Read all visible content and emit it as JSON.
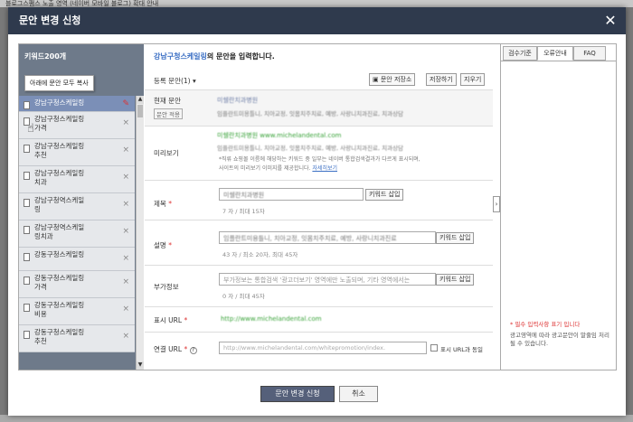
{
  "background": {
    "top_text": "블로그스팸스 노출 영역 (네이버 모바일 블로그) 확대 안내",
    "accent": "#2f3a4d"
  },
  "modal": {
    "title": "문안 변경 신청",
    "close_icon": "close-icon"
  },
  "left_panel": {
    "header": "키워드200개",
    "tooltip": "아래에 문안 모두 복사",
    "items": [
      {
        "label": "강남구청스케일링",
        "selected": true
      },
      {
        "label": "강남구청스케일링\n가격"
      },
      {
        "label": "강남구청스케일링\n추천"
      },
      {
        "label": "강남구청스케일링\n치과"
      },
      {
        "label": "강남구청역스케일\n링"
      },
      {
        "label": "강남구청역스케일\n링치과"
      },
      {
        "label": "강동구청스케일링"
      },
      {
        "label": "강동구청스케일링\n가격"
      },
      {
        "label": "강동구청스케일링\n비용"
      },
      {
        "label": "강동구청스케일링\n추천"
      }
    ]
  },
  "center": {
    "heading_keyword": "강남구청스케일링",
    "heading_rest": "의 문안을 입력합니다.",
    "toolbar": {
      "select_label": "등록 문안(1)",
      "save_btn": "문안 저장소",
      "temp_save_btn": "저장하기",
      "clear_btn": "지우기"
    },
    "current": {
      "label": "현재 문안",
      "tag": "문안 적용",
      "line1": "미쉘란치과병원",
      "line2": "임플란트미용틀니, 치아교정, 잇몸치주치료, 예방, 사랑니치과진료, 치과상담"
    },
    "preview": {
      "label": "미리보기",
      "line1": "미쉘란치과병원 www.michelandental.com",
      "line2": "임플란트미용틀니, 치아교정, 잇몸치주치료, 예방, 사랑니치과진료, 치과상담",
      "note": "*직류 쇼핑몰 이름에 해당하는 키워드 중 일부는 네이버 통합검색결과가 다르게 표시되며,",
      "note2": "사이트의 미리보기 이미지를 제공합니다.",
      "note_link": "자세히보기"
    },
    "title_field": {
      "label": "제목",
      "value": "미쉘란치과병원",
      "insert_btn": "키워드 삽입",
      "count": "7 자 / 최대 15자"
    },
    "desc_field": {
      "label": "설명",
      "value": "임플란트미용틀니, 치아교정, 잇몸치주치료, 예방, 사랑니치과진료",
      "insert_btn": "키워드 삽입",
      "count": "43 자 / 최소 20자, 최대 45자"
    },
    "extra_field": {
      "label": "부가정보",
      "value": "부가정보는 통합검색 '광고더보기' 영역에만 노출되며, 기타 영역에서는",
      "insert_btn": "키워드 삽입",
      "count": "0 자 / 최대 45자"
    },
    "display_url": {
      "label": "표시 URL",
      "value": "http://www.michelandental.com"
    },
    "link_url": {
      "label": "연결 URL",
      "value": "http://www.michelandental.com/whitepromotion/index.",
      "checkbox_label": "표시 URL과 동일"
    }
  },
  "right_panel": {
    "tabs": [
      "검수기준",
      "오류안내",
      "FAQ"
    ],
    "active_tab": 1,
    "note_required": "* 필수 입력사항 표기 입니다",
    "note2": "광고영역에 따라 광고문안이 말줄임 처리될 수 있습니다."
  },
  "footer": {
    "submit": "문안 변경 신청",
    "cancel": "취소"
  }
}
